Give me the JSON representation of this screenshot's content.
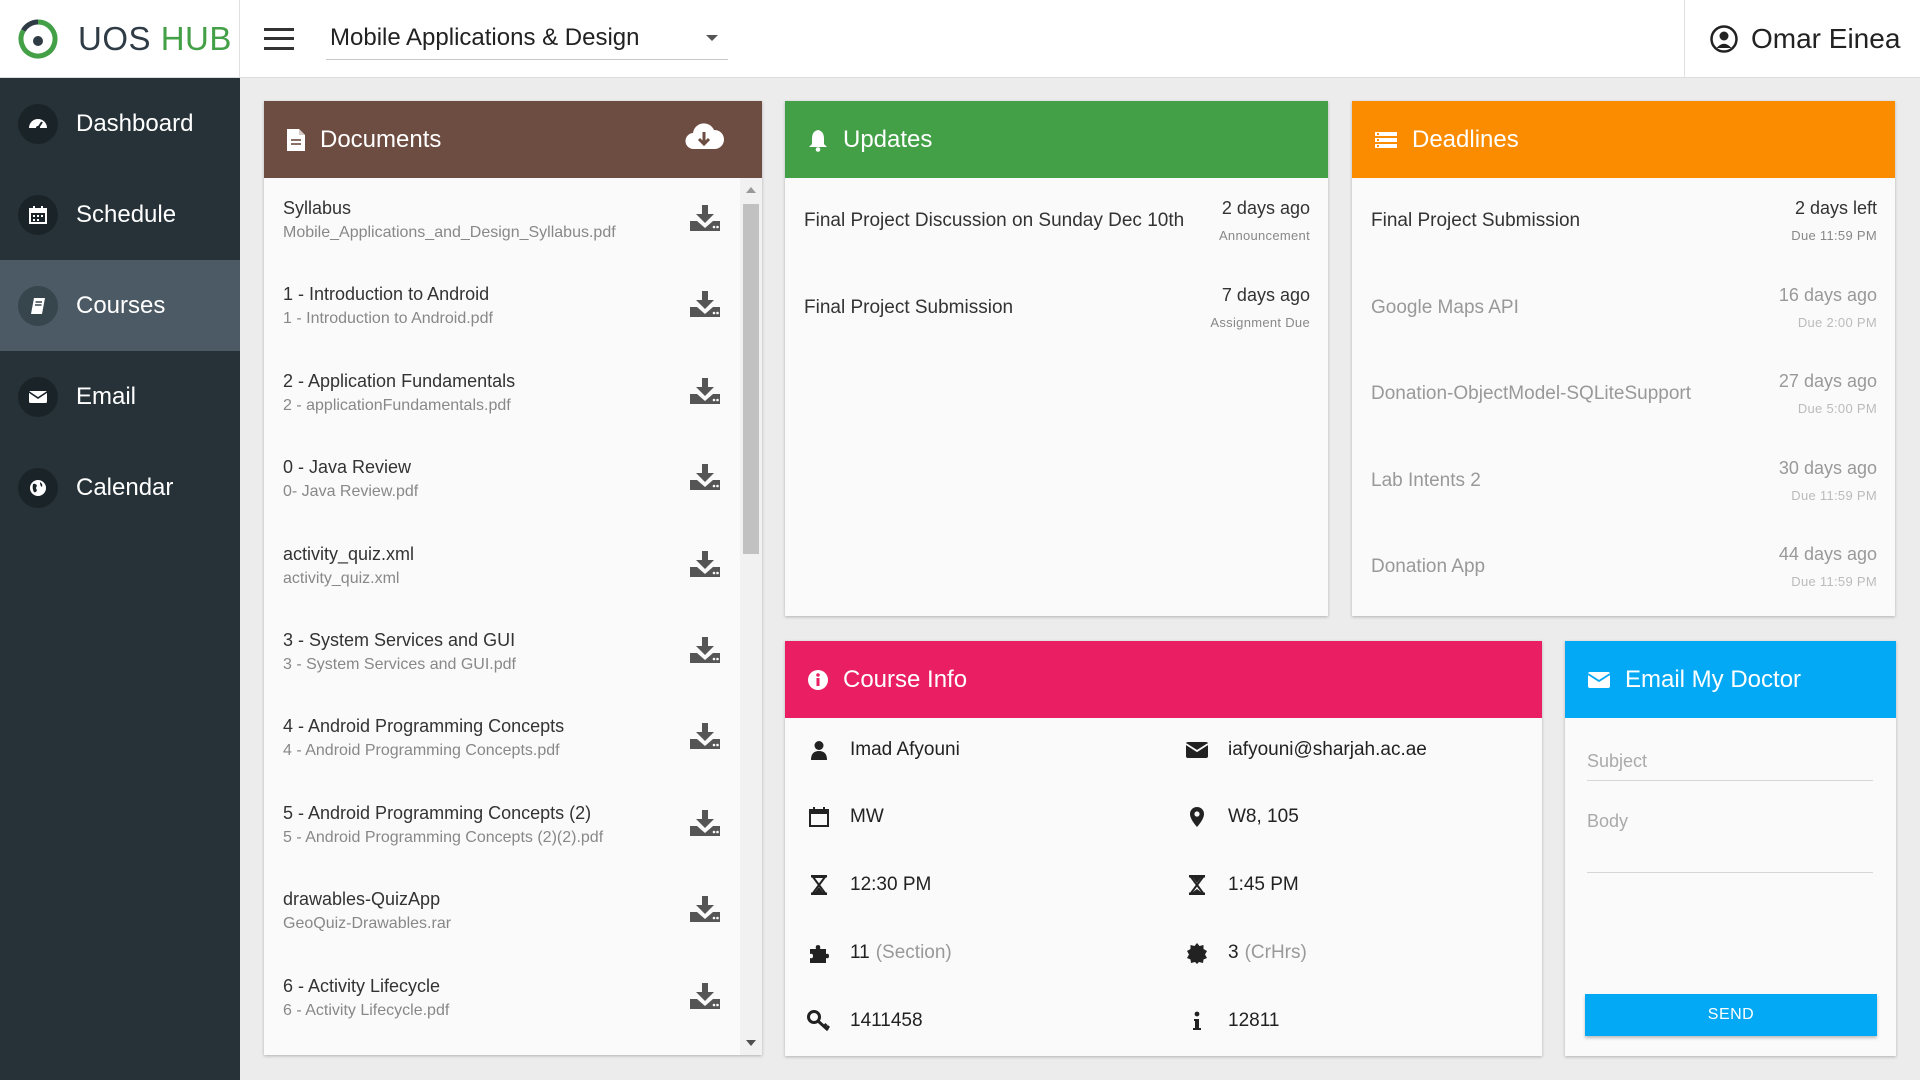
{
  "brand": {
    "name_part1": "UOS",
    "name_part2": "HUB",
    "accent_color": "#43a047"
  },
  "header": {
    "course_select_value": "Mobile Applications & Design",
    "user_name": "Omar Einea"
  },
  "sidebar": {
    "items": [
      {
        "label": "Dashboard",
        "icon": "dashboard-icon",
        "active": false
      },
      {
        "label": "Schedule",
        "icon": "calendar-grid-icon",
        "active": false
      },
      {
        "label": "Courses",
        "icon": "book-icon",
        "active": true
      },
      {
        "label": "Email",
        "icon": "envelope-icon",
        "active": false
      },
      {
        "label": "Calendar",
        "icon": "globe-icon",
        "active": false
      }
    ]
  },
  "documents": {
    "title": "Documents",
    "color": "#6d4c41",
    "items": [
      {
        "title": "Syllabus",
        "file": "Mobile_Applications_and_Design_Syllabus.pdf"
      },
      {
        "title": "1 - Introduction to Android",
        "file": "1 - Introduction to Android.pdf"
      },
      {
        "title": "2 - Application Fundamentals",
        "file": "2 - applicationFundamentals.pdf"
      },
      {
        "title": "0 - Java Review",
        "file": "0- Java Review.pdf"
      },
      {
        "title": "activity_quiz.xml",
        "file": "activity_quiz.xml"
      },
      {
        "title": "3 - System Services and GUI",
        "file": "3 - System Services and GUI.pdf"
      },
      {
        "title": "4 - Android Programming Concepts",
        "file": "4 - Android Programming Concepts.pdf"
      },
      {
        "title": "5 - Android Programming Concepts (2)",
        "file": "5 - Android Programming Concepts (2)(2).pdf"
      },
      {
        "title": "drawables-QuizApp",
        "file": "GeoQuiz-Drawables.rar"
      },
      {
        "title": "6 - Activity Lifecycle",
        "file": "6 - Activity Lifecycle.pdf"
      }
    ]
  },
  "updates": {
    "title": "Updates",
    "color": "#43a047",
    "items": [
      {
        "title": "Final Project Discussion on Sunday Dec 10th",
        "time": "2 days ago",
        "type": "Announcement"
      },
      {
        "title": "Final Project Submission",
        "time": "7 days ago",
        "type": "Assignment Due"
      }
    ]
  },
  "deadlines": {
    "title": "Deadlines",
    "color": "#fb8c00",
    "items": [
      {
        "title": "Final Project Submission",
        "time": "2 days left",
        "due": "Due 11:59 PM",
        "past": false
      },
      {
        "title": "Google Maps API",
        "time": "16 days ago",
        "due": "Due 2:00 PM",
        "past": true
      },
      {
        "title": "Donation-ObjectModel-SQLiteSupport",
        "time": "27 days ago",
        "due": "Due 5:00 PM",
        "past": true
      },
      {
        "title": "Lab Intents 2",
        "time": "30 days ago",
        "due": "Due 11:59 PM",
        "past": true
      },
      {
        "title": "Donation App",
        "time": "44 days ago",
        "due": "Due 11:59 PM",
        "past": true
      }
    ]
  },
  "course_info": {
    "title": "Course Info",
    "color": "#e91e63",
    "instructor": "Imad Afyouni",
    "email": "iafyouni@sharjah.ac.ae",
    "days": "MW",
    "room": "W8, 105",
    "start_time": "12:30 PM",
    "end_time": "1:45 PM",
    "section": "11",
    "section_label": "(Section)",
    "credit_hours": "3",
    "credit_label": "(CrHrs)",
    "crn": "1411458",
    "course_id": "12811"
  },
  "email_doctor": {
    "title": "Email My Doctor",
    "color": "#03a9f4",
    "subject_placeholder": "Subject",
    "body_placeholder": "Body",
    "send_label": "SEND"
  }
}
